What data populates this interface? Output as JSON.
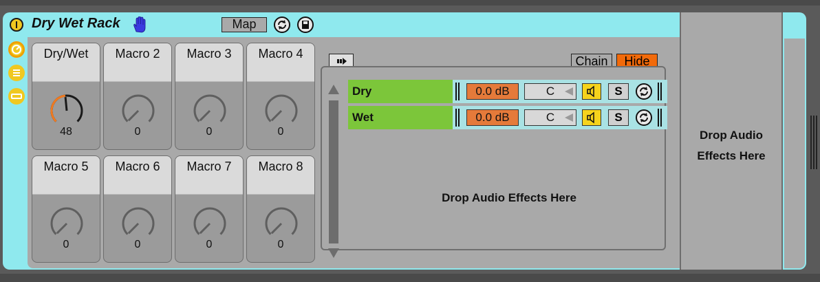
{
  "rack": {
    "title": "Dry Wet Rack",
    "map_label": "Map",
    "accent": "#8fe9ee"
  },
  "macros": [
    {
      "label": "Dry/Wet",
      "value": "48",
      "level": 0.48
    },
    {
      "label": "Macro 2",
      "value": "0",
      "level": 0
    },
    {
      "label": "Macro 3",
      "value": "0",
      "level": 0
    },
    {
      "label": "Macro 4",
      "value": "0",
      "level": 0
    },
    {
      "label": "Macro 5",
      "value": "0",
      "level": 0
    },
    {
      "label": "Macro 6",
      "value": "0",
      "level": 0
    },
    {
      "label": "Macro 7",
      "value": "0",
      "level": 0
    },
    {
      "label": "Macro 8",
      "value": "0",
      "level": 0
    }
  ],
  "chain_list": {
    "chain_button": "Chain",
    "hide_button": "Hide",
    "rows": [
      {
        "name": "Dry",
        "volume": "0.0 dB",
        "pan": "C",
        "solo": "S"
      },
      {
        "name": "Wet",
        "volume": "0.0 dB",
        "pan": "C",
        "solo": "S"
      }
    ]
  },
  "drop_main": "Drop Audio Effects Here",
  "drop_right": {
    "line1": "Drop Audio",
    "line2": "Effects Here"
  },
  "colors": {
    "chain_green": "#7cc63a",
    "volume_orange": "#e57a3a",
    "hide_orange": "#f26a0a",
    "speaker_yellow": "#f6d31c",
    "knob_orange": "#f07a20"
  }
}
